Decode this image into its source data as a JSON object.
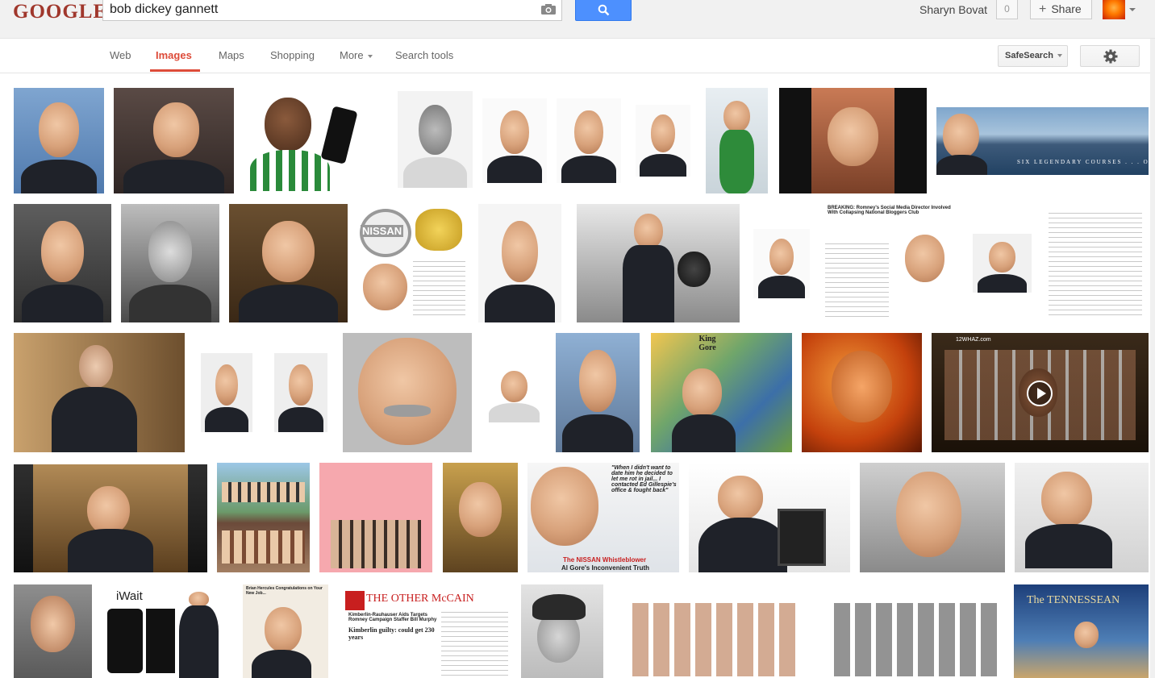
{
  "header": {
    "logo_text": "GOOGLE",
    "search_query": "bob dickey gannett",
    "user_name": "Sharyn Bovat",
    "notification_count": "0",
    "share_label": "Share"
  },
  "nav": {
    "tabs": [
      {
        "label": "Web",
        "active": false
      },
      {
        "label": "Images",
        "active": true
      },
      {
        "label": "Maps",
        "active": false
      },
      {
        "label": "Shopping",
        "active": false
      },
      {
        "label": "More",
        "active": false
      },
      {
        "label": "Search tools",
        "active": false
      }
    ],
    "safesearch_label": "SafeSearch"
  },
  "captions": {
    "c1": "SIX LEGENDARY COURSES . . . ONE EXTRAORDINARY C",
    "c2": "NISSAN",
    "c3": "BREAKING: Romney's Social Media Director Involved With Collapsing National Bloggers Club",
    "c4": "King Gore",
    "c5": "12WHAZ.com",
    "c6": "\"When I didn't want to date him he decided to let me rot in jail... I contacted Ed Gillespie's office & fought back\"",
    "c7": "The NISSAN Whistleblower",
    "c8": "Al Gore's Inconvenient Truth",
    "c9": "iWait",
    "c10": "Brian Hercules Congratulations on Your New Job...",
    "c11": "THE OTHER McCAIN",
    "c12": "Kimberlin-Rauhauser Aids Targets Romney Campaign Staffer Bill Murphy",
    "c13": "Kimberlin guilty: could get 230 years",
    "c14": "The TENNESSEAN"
  },
  "colors": {
    "accent": "#dd4b39",
    "search_blue": "#4d90fe"
  }
}
